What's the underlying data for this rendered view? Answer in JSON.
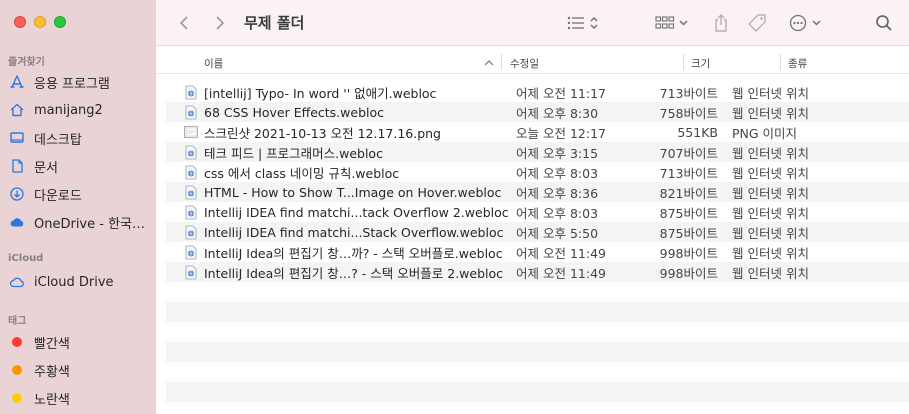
{
  "window": {
    "title": "무제 폴더"
  },
  "sidebar": {
    "favorites_label": "즐겨찾기",
    "favorites": [
      {
        "label": "응용 프로그램",
        "icon": "applications-icon"
      },
      {
        "label": "manijang2",
        "icon": "home-icon"
      },
      {
        "label": "데스크탑",
        "icon": "desktop-icon"
      },
      {
        "label": "문서",
        "icon": "document-icon"
      },
      {
        "label": "다운로드",
        "icon": "download-icon"
      },
      {
        "label": "OneDrive - 한국…",
        "icon": "cloud-icon"
      }
    ],
    "icloud_label": "iCloud",
    "icloud": [
      {
        "label": "iCloud Drive",
        "icon": "icloud-icon"
      }
    ],
    "tags_label": "태그",
    "tags": [
      {
        "label": "빨간색",
        "color": "#fe3b30"
      },
      {
        "label": "주황색",
        "color": "#fe9500"
      },
      {
        "label": "노란색",
        "color": "#fecc00"
      }
    ]
  },
  "columns": {
    "name": "이름",
    "date": "수정일",
    "size": "크기",
    "kind": "종류"
  },
  "files": [
    {
      "name": "[intellij] Typo- In word '' 없애기.webloc",
      "date": "어제 오전 11:17",
      "size": "713바이트",
      "kind": "웹 인터넷 위치",
      "type": "webloc"
    },
    {
      "name": "68 CSS Hover Effects.webloc",
      "date": "어제 오후 8:30",
      "size": "758바이트",
      "kind": "웹 인터넷 위치",
      "type": "webloc"
    },
    {
      "name": "스크린샷 2021-10-13 오전 12.17.16.png",
      "date": "오늘 오전 12:17",
      "size": "551KB",
      "kind": "PNG 이미지",
      "type": "png"
    },
    {
      "name": "테크 피드 | 프로그래머스.webloc",
      "date": "어제 오후 3:15",
      "size": "707바이트",
      "kind": "웹 인터넷 위치",
      "type": "webloc"
    },
    {
      "name": "css 에서 class 네이밍 규칙.webloc",
      "date": "어제 오후 8:03",
      "size": "713바이트",
      "kind": "웹 인터넷 위치",
      "type": "webloc"
    },
    {
      "name": "HTML - How to Show T...Image on Hover.webloc",
      "date": "어제 오후 8:36",
      "size": "821바이트",
      "kind": "웹 인터넷 위치",
      "type": "webloc"
    },
    {
      "name": "Intellij IDEA find matchi...tack Overflow 2.webloc",
      "date": "어제 오후 8:03",
      "size": "875바이트",
      "kind": "웹 인터넷 위치",
      "type": "webloc"
    },
    {
      "name": "Intellij IDEA find matchi...Stack Overflow.webloc",
      "date": "어제 오후 5:50",
      "size": "875바이트",
      "kind": "웹 인터넷 위치",
      "type": "webloc"
    },
    {
      "name": "IntelliJ Idea의 편집기 창…까? - 스택 오버플로.webloc",
      "date": "어제 오전 11:49",
      "size": "998바이트",
      "kind": "웹 인터넷 위치",
      "type": "webloc"
    },
    {
      "name": "IntelliJ Idea의 편집기 창…? - 스택 오버플로 2.webloc",
      "date": "어제 오전 11:49",
      "size": "998바이트",
      "kind": "웹 인터넷 위치",
      "type": "webloc"
    }
  ]
}
